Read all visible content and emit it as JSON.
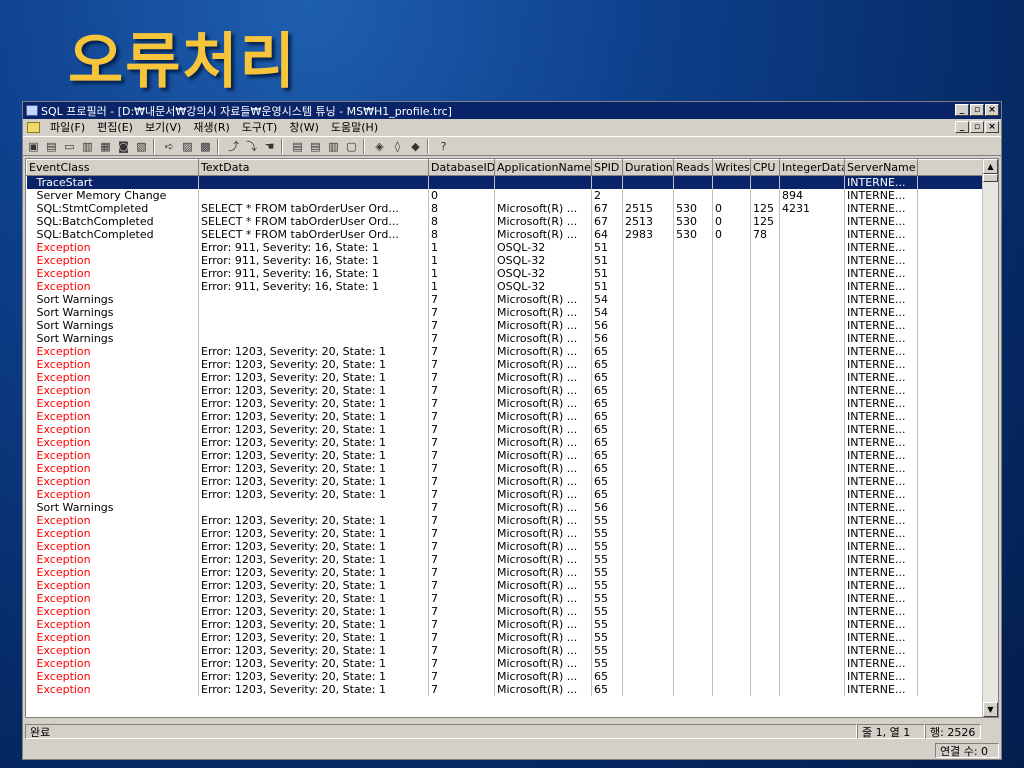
{
  "slide": {
    "title": "오류처리"
  },
  "window": {
    "title": "SQL 프로필러 - [D:₩내문서₩강의시 자료들₩운영시스템 튜닝 - MS₩H1_profile.trc]",
    "controls": [
      "_",
      "▫",
      "×"
    ]
  },
  "menu": {
    "items": [
      "파일(F)",
      "편집(E)",
      "보기(V)",
      "재생(R)",
      "도구(T)",
      "창(W)",
      "도움말(H)"
    ]
  },
  "toolbar": {
    "buttons": [
      "new-trace-icon",
      "new-template-icon",
      "open-icon",
      "open-template-icon",
      "properties-icon",
      "find-icon",
      "replay-icon",
      "step-icon",
      "run-to-cursor-icon",
      "cut-icon",
      "pause-icon",
      "stop-icon",
      "toggle-breakpoint-icon",
      "clear-icon",
      "show-icon",
      "hide-icon",
      "clear-window-icon",
      "help-icon",
      "index-tuning-icon",
      "tuning-wizard-icon",
      "about-icon"
    ]
  },
  "grid": {
    "columns": [
      "EventClass",
      "TextData",
      "DatabaseID",
      "ApplicationName",
      "SPID",
      "Duration",
      "Reads",
      "Writes",
      "CPU",
      "IntegerData",
      "ServerName",
      ""
    ],
    "rows": [
      {
        "type": "selected",
        "cells": [
          "TraceStart",
          "",
          "",
          "",
          "",
          "",
          "",
          "",
          "",
          "",
          "INTERNE...",
          ""
        ]
      },
      {
        "type": "normal",
        "cells": [
          "Server Memory Change",
          "",
          "0",
          "",
          "2",
          "",
          "",
          "",
          "",
          "894",
          "INTERNE...",
          ""
        ]
      },
      {
        "type": "normal",
        "cells": [
          "SQL:StmtCompleted",
          "SELECT * FROM tabOrderUser Ord...",
          "8",
          "Microsoft(R) ...",
          "67",
          "2515",
          "530",
          "0",
          "125",
          "4231",
          "INTERNE...",
          ""
        ]
      },
      {
        "type": "normal",
        "cells": [
          "SQL:BatchCompleted",
          "SELECT * FROM tabOrderUser Ord...",
          "8",
          "Microsoft(R) ...",
          "67",
          "2513",
          "530",
          "0",
          "125",
          "",
          "INTERNE...",
          ""
        ]
      },
      {
        "type": "normal",
        "cells": [
          "SQL:BatchCompleted",
          "SELECT * FROM tabOrderUser Ord...",
          "8",
          "Microsoft(R) ...",
          "64",
          "2983",
          "530",
          "0",
          "78",
          "",
          "INTERNE...",
          ""
        ]
      },
      {
        "type": "exception",
        "cells": [
          "Exception",
          "Error: 911, Severity: 16, State: 1",
          "1",
          "OSQL-32",
          "51",
          "",
          "",
          "",
          "",
          "",
          "INTERNE...",
          ""
        ]
      },
      {
        "type": "exception",
        "cells": [
          "Exception",
          "Error: 911, Severity: 16, State: 1",
          "1",
          "OSQL-32",
          "51",
          "",
          "",
          "",
          "",
          "",
          "INTERNE...",
          ""
        ]
      },
      {
        "type": "exception",
        "cells": [
          "Exception",
          "Error: 911, Severity: 16, State: 1",
          "1",
          "OSQL-32",
          "51",
          "",
          "",
          "",
          "",
          "",
          "INTERNE...",
          ""
        ]
      },
      {
        "type": "exception",
        "cells": [
          "Exception",
          "Error: 911, Severity: 16, State: 1",
          "1",
          "OSQL-32",
          "51",
          "",
          "",
          "",
          "",
          "",
          "INTERNE...",
          ""
        ]
      },
      {
        "type": "normal",
        "cells": [
          "Sort Warnings",
          "",
          "7",
          "Microsoft(R) ...",
          "54",
          "",
          "",
          "",
          "",
          "",
          "INTERNE...",
          ""
        ]
      },
      {
        "type": "normal",
        "cells": [
          "Sort Warnings",
          "",
          "7",
          "Microsoft(R) ...",
          "54",
          "",
          "",
          "",
          "",
          "",
          "INTERNE...",
          ""
        ]
      },
      {
        "type": "normal",
        "cells": [
          "Sort Warnings",
          "",
          "7",
          "Microsoft(R) ...",
          "56",
          "",
          "",
          "",
          "",
          "",
          "INTERNE...",
          ""
        ]
      },
      {
        "type": "normal",
        "cells": [
          "Sort Warnings",
          "",
          "7",
          "Microsoft(R) ...",
          "56",
          "",
          "",
          "",
          "",
          "",
          "INTERNE...",
          ""
        ]
      },
      {
        "type": "exception",
        "cells": [
          "Exception",
          "Error: 1203, Severity: 20, State: 1",
          "7",
          "Microsoft(R) ...",
          "65",
          "",
          "",
          "",
          "",
          "",
          "INTERNE...",
          ""
        ]
      },
      {
        "type": "exception",
        "cells": [
          "Exception",
          "Error: 1203, Severity: 20, State: 1",
          "7",
          "Microsoft(R) ...",
          "65",
          "",
          "",
          "",
          "",
          "",
          "INTERNE...",
          ""
        ]
      },
      {
        "type": "exception",
        "cells": [
          "Exception",
          "Error: 1203, Severity: 20, State: 1",
          "7",
          "Microsoft(R) ...",
          "65",
          "",
          "",
          "",
          "",
          "",
          "INTERNE...",
          ""
        ]
      },
      {
        "type": "exception",
        "cells": [
          "Exception",
          "Error: 1203, Severity: 20, State: 1",
          "7",
          "Microsoft(R) ...",
          "65",
          "",
          "",
          "",
          "",
          "",
          "INTERNE...",
          ""
        ]
      },
      {
        "type": "exception",
        "cells": [
          "Exception",
          "Error: 1203, Severity: 20, State: 1",
          "7",
          "Microsoft(R) ...",
          "65",
          "",
          "",
          "",
          "",
          "",
          "INTERNE...",
          ""
        ]
      },
      {
        "type": "exception",
        "cells": [
          "Exception",
          "Error: 1203, Severity: 20, State: 1",
          "7",
          "Microsoft(R) ...",
          "65",
          "",
          "",
          "",
          "",
          "",
          "INTERNE...",
          ""
        ]
      },
      {
        "type": "exception",
        "cells": [
          "Exception",
          "Error: 1203, Severity: 20, State: 1",
          "7",
          "Microsoft(R) ...",
          "65",
          "",
          "",
          "",
          "",
          "",
          "INTERNE...",
          ""
        ]
      },
      {
        "type": "exception",
        "cells": [
          "Exception",
          "Error: 1203, Severity: 20, State: 1",
          "7",
          "Microsoft(R) ...",
          "65",
          "",
          "",
          "",
          "",
          "",
          "INTERNE...",
          ""
        ]
      },
      {
        "type": "exception",
        "cells": [
          "Exception",
          "Error: 1203, Severity: 20, State: 1",
          "7",
          "Microsoft(R) ...",
          "65",
          "",
          "",
          "",
          "",
          "",
          "INTERNE...",
          ""
        ]
      },
      {
        "type": "exception",
        "cells": [
          "Exception",
          "Error: 1203, Severity: 20, State: 1",
          "7",
          "Microsoft(R) ...",
          "65",
          "",
          "",
          "",
          "",
          "",
          "INTERNE...",
          ""
        ]
      },
      {
        "type": "exception",
        "cells": [
          "Exception",
          "Error: 1203, Severity: 20, State: 1",
          "7",
          "Microsoft(R) ...",
          "65",
          "",
          "",
          "",
          "",
          "",
          "INTERNE...",
          ""
        ]
      },
      {
        "type": "exception",
        "cells": [
          "Exception",
          "Error: 1203, Severity: 20, State: 1",
          "7",
          "Microsoft(R) ...",
          "65",
          "",
          "",
          "",
          "",
          "",
          "INTERNE...",
          ""
        ]
      },
      {
        "type": "normal",
        "cells": [
          "Sort Warnings",
          "",
          "7",
          "Microsoft(R) ...",
          "56",
          "",
          "",
          "",
          "",
          "",
          "INTERNE...",
          ""
        ]
      },
      {
        "type": "exception",
        "cells": [
          "Exception",
          "Error: 1203, Severity: 20, State: 1",
          "7",
          "Microsoft(R) ...",
          "55",
          "",
          "",
          "",
          "",
          "",
          "INTERNE...",
          ""
        ]
      },
      {
        "type": "exception",
        "cells": [
          "Exception",
          "Error: 1203, Severity: 20, State: 1",
          "7",
          "Microsoft(R) ...",
          "55",
          "",
          "",
          "",
          "",
          "",
          "INTERNE...",
          ""
        ]
      },
      {
        "type": "exception",
        "cells": [
          "Exception",
          "Error: 1203, Severity: 20, State: 1",
          "7",
          "Microsoft(R) ...",
          "55",
          "",
          "",
          "",
          "",
          "",
          "INTERNE...",
          ""
        ]
      },
      {
        "type": "exception",
        "cells": [
          "Exception",
          "Error: 1203, Severity: 20, State: 1",
          "7",
          "Microsoft(R) ...",
          "55",
          "",
          "",
          "",
          "",
          "",
          "INTERNE...",
          ""
        ]
      },
      {
        "type": "exception",
        "cells": [
          "Exception",
          "Error: 1203, Severity: 20, State: 1",
          "7",
          "Microsoft(R) ...",
          "55",
          "",
          "",
          "",
          "",
          "",
          "INTERNE...",
          ""
        ]
      },
      {
        "type": "exception",
        "cells": [
          "Exception",
          "Error: 1203, Severity: 20, State: 1",
          "7",
          "Microsoft(R) ...",
          "55",
          "",
          "",
          "",
          "",
          "",
          "INTERNE...",
          ""
        ]
      },
      {
        "type": "exception",
        "cells": [
          "Exception",
          "Error: 1203, Severity: 20, State: 1",
          "7",
          "Microsoft(R) ...",
          "55",
          "",
          "",
          "",
          "",
          "",
          "INTERNE...",
          ""
        ]
      },
      {
        "type": "exception",
        "cells": [
          "Exception",
          "Error: 1203, Severity: 20, State: 1",
          "7",
          "Microsoft(R) ...",
          "55",
          "",
          "",
          "",
          "",
          "",
          "INTERNE...",
          ""
        ]
      },
      {
        "type": "exception",
        "cells": [
          "Exception",
          "Error: 1203, Severity: 20, State: 1",
          "7",
          "Microsoft(R) ...",
          "55",
          "",
          "",
          "",
          "",
          "",
          "INTERNE...",
          ""
        ]
      },
      {
        "type": "exception",
        "cells": [
          "Exception",
          "Error: 1203, Severity: 20, State: 1",
          "7",
          "Microsoft(R) ...",
          "55",
          "",
          "",
          "",
          "",
          "",
          "INTERNE...",
          ""
        ]
      },
      {
        "type": "exception",
        "cells": [
          "Exception",
          "Error: 1203, Severity: 20, State: 1",
          "7",
          "Microsoft(R) ...",
          "55",
          "",
          "",
          "",
          "",
          "",
          "INTERNE...",
          ""
        ]
      },
      {
        "type": "exception",
        "cells": [
          "Exception",
          "Error: 1203, Severity: 20, State: 1",
          "7",
          "Microsoft(R) ...",
          "55",
          "",
          "",
          "",
          "",
          "",
          "INTERNE...",
          ""
        ]
      },
      {
        "type": "exception",
        "cells": [
          "Exception",
          "Error: 1203, Severity: 20, State: 1",
          "7",
          "Microsoft(R) ...",
          "65",
          "",
          "",
          "",
          "",
          "",
          "INTERNE...",
          ""
        ]
      },
      {
        "type": "exception",
        "cells": [
          "Exception",
          "Error: 1203, Severity: 20, State: 1",
          "7",
          "Microsoft(R) ...",
          "65",
          "",
          "",
          "",
          "",
          "",
          "INTERNE...",
          ""
        ]
      }
    ]
  },
  "status": {
    "left": "완료",
    "position": "줄 1, 열 1",
    "rows": "행: 2526",
    "connections": "연결 수: 0"
  },
  "colors": {
    "exception": "#ff0000",
    "selection": "#0a246a",
    "title": "#f6c53c"
  }
}
